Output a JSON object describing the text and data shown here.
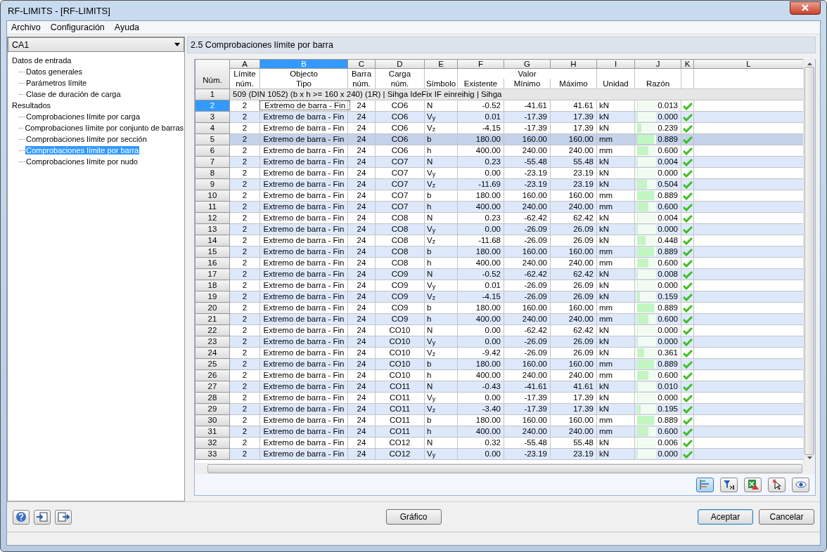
{
  "window": {
    "title": "RF-LIMITS - [RF-LIMITS]"
  },
  "menu": [
    "Archivo",
    "Configuración",
    "Ayuda"
  ],
  "case_select": {
    "value": "CA1"
  },
  "tree": [
    {
      "label": "Datos de entrada",
      "selected": false,
      "children": [
        {
          "label": "Datos generales",
          "selected": false
        },
        {
          "label": "Parámetros límite",
          "selected": false
        },
        {
          "label": "Clase de duración de carga",
          "selected": false
        }
      ]
    },
    {
      "label": "Resultados",
      "selected": false,
      "children": [
        {
          "label": "Comprobaciones límite por carga",
          "selected": false
        },
        {
          "label": "Comprobaciones límite por conjunto de barras",
          "selected": false
        },
        {
          "label": "Comprobaciones límite por sección",
          "selected": false
        },
        {
          "label": "Comprobaciones límite por barra",
          "selected": true
        },
        {
          "label": "Comprobaciones límite por nudo",
          "selected": false
        }
      ]
    }
  ],
  "panel_title": "2.5 Comprobaciones límite por barra",
  "table": {
    "corner": "Núm.",
    "columns": [
      {
        "letter": "A",
        "top": "Límite",
        "bottom": "núm.",
        "selected": false
      },
      {
        "letter": "B",
        "top": "Objecto",
        "bottom": "Tipo",
        "selected": true
      },
      {
        "letter": "C",
        "top": "Barra",
        "bottom": "núm.",
        "selected": false
      },
      {
        "letter": "D",
        "top": "Carga",
        "bottom": "núm.",
        "selected": false
      },
      {
        "letter": "E",
        "bottom": "Símbolo",
        "selected": false
      },
      {
        "letter": "F",
        "top": "Valor",
        "bottom": "Existente",
        "selected": false
      },
      {
        "letter": "G",
        "bottom": "Mínimo",
        "selected": false
      },
      {
        "letter": "H",
        "bottom": "Máximo",
        "selected": false
      },
      {
        "letter": "I",
        "bottom": "Unidad",
        "selected": false
      },
      {
        "letter": "J",
        "bottom": "Razón",
        "selected": false
      },
      {
        "letter": "K",
        "selected": false
      },
      {
        "letter": "L",
        "selected": false
      }
    ],
    "group_row": {
      "num": "1",
      "text": "509 (DIN 1052) (b x h >= 160 x 240) (1R) | Sihga IdeFix IF einreihig | Sihga"
    },
    "rows": [
      {
        "num": "2",
        "limit": "2",
        "type": "Extremo de barra - Fin",
        "bar": "24",
        "load": "CO6",
        "symbol": "N",
        "existing": "-0.52",
        "min": "-41.61",
        "max": "41.61",
        "unit": "kN",
        "ratio": "0.013",
        "level": 0.013,
        "ok": true,
        "selected": false,
        "focused": true
      },
      {
        "num": "3",
        "limit": "2",
        "type": "Extremo de barra - Fin",
        "bar": "24",
        "load": "CO6",
        "symbol": "V$_{y}$",
        "existing": "0.01",
        "min": "-17.39",
        "max": "17.39",
        "unit": "kN",
        "ratio": "0.000",
        "level": 0,
        "ok": true,
        "selected": false,
        "focused": false
      },
      {
        "num": "4",
        "limit": "2",
        "type": "Extremo de barra - Fin",
        "bar": "24",
        "load": "CO6",
        "symbol": "V$_{z}$",
        "existing": "-4.15",
        "min": "-17.39",
        "max": "17.39",
        "unit": "kN",
        "ratio": "0.239",
        "level": 0.239,
        "ok": true,
        "selected": false,
        "focused": false
      },
      {
        "num": "5",
        "limit": "2",
        "type": "Extremo de barra - Fin",
        "bar": "24",
        "load": "CO6",
        "symbol": "b",
        "existing": "180.00",
        "min": "160.00",
        "max": "160.00",
        "unit": "mm",
        "ratio": "0.889",
        "level": 0.889,
        "ok": true,
        "selected": true,
        "focused": false
      },
      {
        "num": "6",
        "limit": "2",
        "type": "Extremo de barra - Fin",
        "bar": "24",
        "load": "CO6",
        "symbol": "h",
        "existing": "400.00",
        "min": "240.00",
        "max": "240.00",
        "unit": "mm",
        "ratio": "0.600",
        "level": 0.6,
        "ok": true,
        "selected": false,
        "focused": false
      },
      {
        "num": "7",
        "limit": "2",
        "type": "Extremo de barra - Fin",
        "bar": "24",
        "load": "CO7",
        "symbol": "N",
        "existing": "0.23",
        "min": "-55.48",
        "max": "55.48",
        "unit": "kN",
        "ratio": "0.004",
        "level": 0.004,
        "ok": true,
        "selected": false,
        "focused": false
      },
      {
        "num": "8",
        "limit": "2",
        "type": "Extremo de barra - Fin",
        "bar": "24",
        "load": "CO7",
        "symbol": "V$_{y}$",
        "existing": "0.00",
        "min": "-23.19",
        "max": "23.19",
        "unit": "kN",
        "ratio": "0.000",
        "level": 0,
        "ok": true,
        "selected": false,
        "focused": false
      },
      {
        "num": "9",
        "limit": "2",
        "type": "Extremo de barra - Fin",
        "bar": "24",
        "load": "CO7",
        "symbol": "V$_{z}$",
        "existing": "-11.69",
        "min": "-23.19",
        "max": "23.19",
        "unit": "kN",
        "ratio": "0.504",
        "level": 0.504,
        "ok": true,
        "selected": false,
        "focused": false
      },
      {
        "num": "10",
        "limit": "2",
        "type": "Extremo de barra - Fin",
        "bar": "24",
        "load": "CO7",
        "symbol": "b",
        "existing": "180.00",
        "min": "160.00",
        "max": "160.00",
        "unit": "mm",
        "ratio": "0.889",
        "level": 0.889,
        "ok": true,
        "selected": false,
        "focused": false
      },
      {
        "num": "11",
        "limit": "2",
        "type": "Extremo de barra - Fin",
        "bar": "24",
        "load": "CO7",
        "symbol": "h",
        "existing": "400.00",
        "min": "240.00",
        "max": "240.00",
        "unit": "mm",
        "ratio": "0.600",
        "level": 0.6,
        "ok": true,
        "selected": false,
        "focused": false
      },
      {
        "num": "12",
        "limit": "2",
        "type": "Extremo de barra - Fin",
        "bar": "24",
        "load": "CO8",
        "symbol": "N",
        "existing": "0.23",
        "min": "-62.42",
        "max": "62.42",
        "unit": "kN",
        "ratio": "0.004",
        "level": 0.004,
        "ok": true,
        "selected": false,
        "focused": false
      },
      {
        "num": "13",
        "limit": "2",
        "type": "Extremo de barra - Fin",
        "bar": "24",
        "load": "CO8",
        "symbol": "V$_{y}$",
        "existing": "0.00",
        "min": "-26.09",
        "max": "26.09",
        "unit": "kN",
        "ratio": "0.000",
        "level": 0,
        "ok": true,
        "selected": false,
        "focused": false
      },
      {
        "num": "14",
        "limit": "2",
        "type": "Extremo de barra - Fin",
        "bar": "24",
        "load": "CO8",
        "symbol": "V$_{z}$",
        "existing": "-11.68",
        "min": "-26.09",
        "max": "26.09",
        "unit": "kN",
        "ratio": "0.448",
        "level": 0.448,
        "ok": true,
        "selected": false,
        "focused": false
      },
      {
        "num": "15",
        "limit": "2",
        "type": "Extremo de barra - Fin",
        "bar": "24",
        "load": "CO8",
        "symbol": "b",
        "existing": "180.00",
        "min": "160.00",
        "max": "160.00",
        "unit": "mm",
        "ratio": "0.889",
        "level": 0.889,
        "ok": true,
        "selected": false,
        "focused": false
      },
      {
        "num": "16",
        "limit": "2",
        "type": "Extremo de barra - Fin",
        "bar": "24",
        "load": "CO8",
        "symbol": "h",
        "existing": "400.00",
        "min": "240.00",
        "max": "240.00",
        "unit": "mm",
        "ratio": "0.600",
        "level": 0.6,
        "ok": true,
        "selected": false,
        "focused": false
      },
      {
        "num": "17",
        "limit": "2",
        "type": "Extremo de barra - Fin",
        "bar": "24",
        "load": "CO9",
        "symbol": "N",
        "existing": "-0.52",
        "min": "-62.42",
        "max": "62.42",
        "unit": "kN",
        "ratio": "0.008",
        "level": 0.008,
        "ok": true,
        "selected": false,
        "focused": false
      },
      {
        "num": "18",
        "limit": "2",
        "type": "Extremo de barra - Fin",
        "bar": "24",
        "load": "CO9",
        "symbol": "V$_{y}$",
        "existing": "0.01",
        "min": "-26.09",
        "max": "26.09",
        "unit": "kN",
        "ratio": "0.000",
        "level": 0,
        "ok": true,
        "selected": false,
        "focused": false
      },
      {
        "num": "19",
        "limit": "2",
        "type": "Extremo de barra - Fin",
        "bar": "24",
        "load": "CO9",
        "symbol": "V$_{z}$",
        "existing": "-4.15",
        "min": "-26.09",
        "max": "26.09",
        "unit": "kN",
        "ratio": "0.159",
        "level": 0.159,
        "ok": true,
        "selected": false,
        "focused": false
      },
      {
        "num": "20",
        "limit": "2",
        "type": "Extremo de barra - Fin",
        "bar": "24",
        "load": "CO9",
        "symbol": "b",
        "existing": "180.00",
        "min": "160.00",
        "max": "160.00",
        "unit": "mm",
        "ratio": "0.889",
        "level": 0.889,
        "ok": true,
        "selected": false,
        "focused": false
      },
      {
        "num": "21",
        "limit": "2",
        "type": "Extremo de barra - Fin",
        "bar": "24",
        "load": "CO9",
        "symbol": "h",
        "existing": "400.00",
        "min": "240.00",
        "max": "240.00",
        "unit": "mm",
        "ratio": "0.600",
        "level": 0.6,
        "ok": true,
        "selected": false,
        "focused": false
      },
      {
        "num": "22",
        "limit": "2",
        "type": "Extremo de barra - Fin",
        "bar": "24",
        "load": "CO10",
        "symbol": "N",
        "existing": "0.00",
        "min": "-62.42",
        "max": "62.42",
        "unit": "kN",
        "ratio": "0.000",
        "level": 0,
        "ok": true,
        "selected": false,
        "focused": false
      },
      {
        "num": "23",
        "limit": "2",
        "type": "Extremo de barra - Fin",
        "bar": "24",
        "load": "CO10",
        "symbol": "V$_{y}$",
        "existing": "0.00",
        "min": "-26.09",
        "max": "26.09",
        "unit": "kN",
        "ratio": "0.000",
        "level": 0,
        "ok": true,
        "selected": false,
        "focused": false
      },
      {
        "num": "24",
        "limit": "2",
        "type": "Extremo de barra - Fin",
        "bar": "24",
        "load": "CO10",
        "symbol": "V$_{z}$",
        "existing": "-9.42",
        "min": "-26.09",
        "max": "26.09",
        "unit": "kN",
        "ratio": "0.361",
        "level": 0.361,
        "ok": true,
        "selected": false,
        "focused": false
      },
      {
        "num": "25",
        "limit": "2",
        "type": "Extremo de barra - Fin",
        "bar": "24",
        "load": "CO10",
        "symbol": "b",
        "existing": "180.00",
        "min": "160.00",
        "max": "160.00",
        "unit": "mm",
        "ratio": "0.889",
        "level": 0.889,
        "ok": true,
        "selected": false,
        "focused": false
      },
      {
        "num": "26",
        "limit": "2",
        "type": "Extremo de barra - Fin",
        "bar": "24",
        "load": "CO10",
        "symbol": "h",
        "existing": "400.00",
        "min": "240.00",
        "max": "240.00",
        "unit": "mm",
        "ratio": "0.600",
        "level": 0.6,
        "ok": true,
        "selected": false,
        "focused": false
      },
      {
        "num": "27",
        "limit": "2",
        "type": "Extremo de barra - Fin",
        "bar": "24",
        "load": "CO11",
        "symbol": "N",
        "existing": "-0.43",
        "min": "-41.61",
        "max": "41.61",
        "unit": "kN",
        "ratio": "0.010",
        "level": 0.01,
        "ok": true,
        "selected": false,
        "focused": false
      },
      {
        "num": "28",
        "limit": "2",
        "type": "Extremo de barra - Fin",
        "bar": "24",
        "load": "CO11",
        "symbol": "V$_{y}$",
        "existing": "0.00",
        "min": "-17.39",
        "max": "17.39",
        "unit": "kN",
        "ratio": "0.000",
        "level": 0,
        "ok": true,
        "selected": false,
        "focused": false
      },
      {
        "num": "29",
        "limit": "2",
        "type": "Extremo de barra - Fin",
        "bar": "24",
        "load": "CO11",
        "symbol": "V$_{z}$",
        "existing": "-3.40",
        "min": "-17.39",
        "max": "17.39",
        "unit": "kN",
        "ratio": "0.195",
        "level": 0.195,
        "ok": true,
        "selected": false,
        "focused": false
      },
      {
        "num": "30",
        "limit": "2",
        "type": "Extremo de barra - Fin",
        "bar": "24",
        "load": "CO11",
        "symbol": "b",
        "existing": "180.00",
        "min": "160.00",
        "max": "160.00",
        "unit": "mm",
        "ratio": "0.889",
        "level": 0.889,
        "ok": true,
        "selected": false,
        "focused": false
      },
      {
        "num": "31",
        "limit": "2",
        "type": "Extremo de barra - Fin",
        "bar": "24",
        "load": "CO11",
        "symbol": "h",
        "existing": "400.00",
        "min": "240.00",
        "max": "240.00",
        "unit": "mm",
        "ratio": "0.600",
        "level": 0.6,
        "ok": true,
        "selected": false,
        "focused": false
      },
      {
        "num": "32",
        "limit": "2",
        "type": "Extremo de barra - Fin",
        "bar": "24",
        "load": "CO12",
        "symbol": "N",
        "existing": "0.32",
        "min": "-55.48",
        "max": "55.48",
        "unit": "kN",
        "ratio": "0.006",
        "level": 0.006,
        "ok": true,
        "selected": false,
        "focused": false
      },
      {
        "num": "33",
        "limit": "2",
        "type": "Extremo de barra - Fin",
        "bar": "24",
        "load": "CO12",
        "symbol": "V$_{y}$",
        "existing": "0.00",
        "min": "-23.19",
        "max": "23.19",
        "unit": "kN",
        "ratio": "0.000",
        "level": 0,
        "ok": true,
        "selected": false,
        "focused": false
      }
    ]
  },
  "toolbar": [
    {
      "kind": "bars",
      "selected": true
    },
    {
      "kind": "filter",
      "selected": false
    },
    {
      "kind": "excel",
      "selected": false
    },
    {
      "kind": "pick",
      "selected": false
    },
    {
      "kind": "eye",
      "selected": false
    }
  ],
  "left_buttons": [
    {
      "kind": "help"
    },
    {
      "kind": "import"
    },
    {
      "kind": "export"
    }
  ],
  "graphic_button": "Gráfico",
  "buttons": [
    "Aceptar",
    "Cancelar"
  ]
}
